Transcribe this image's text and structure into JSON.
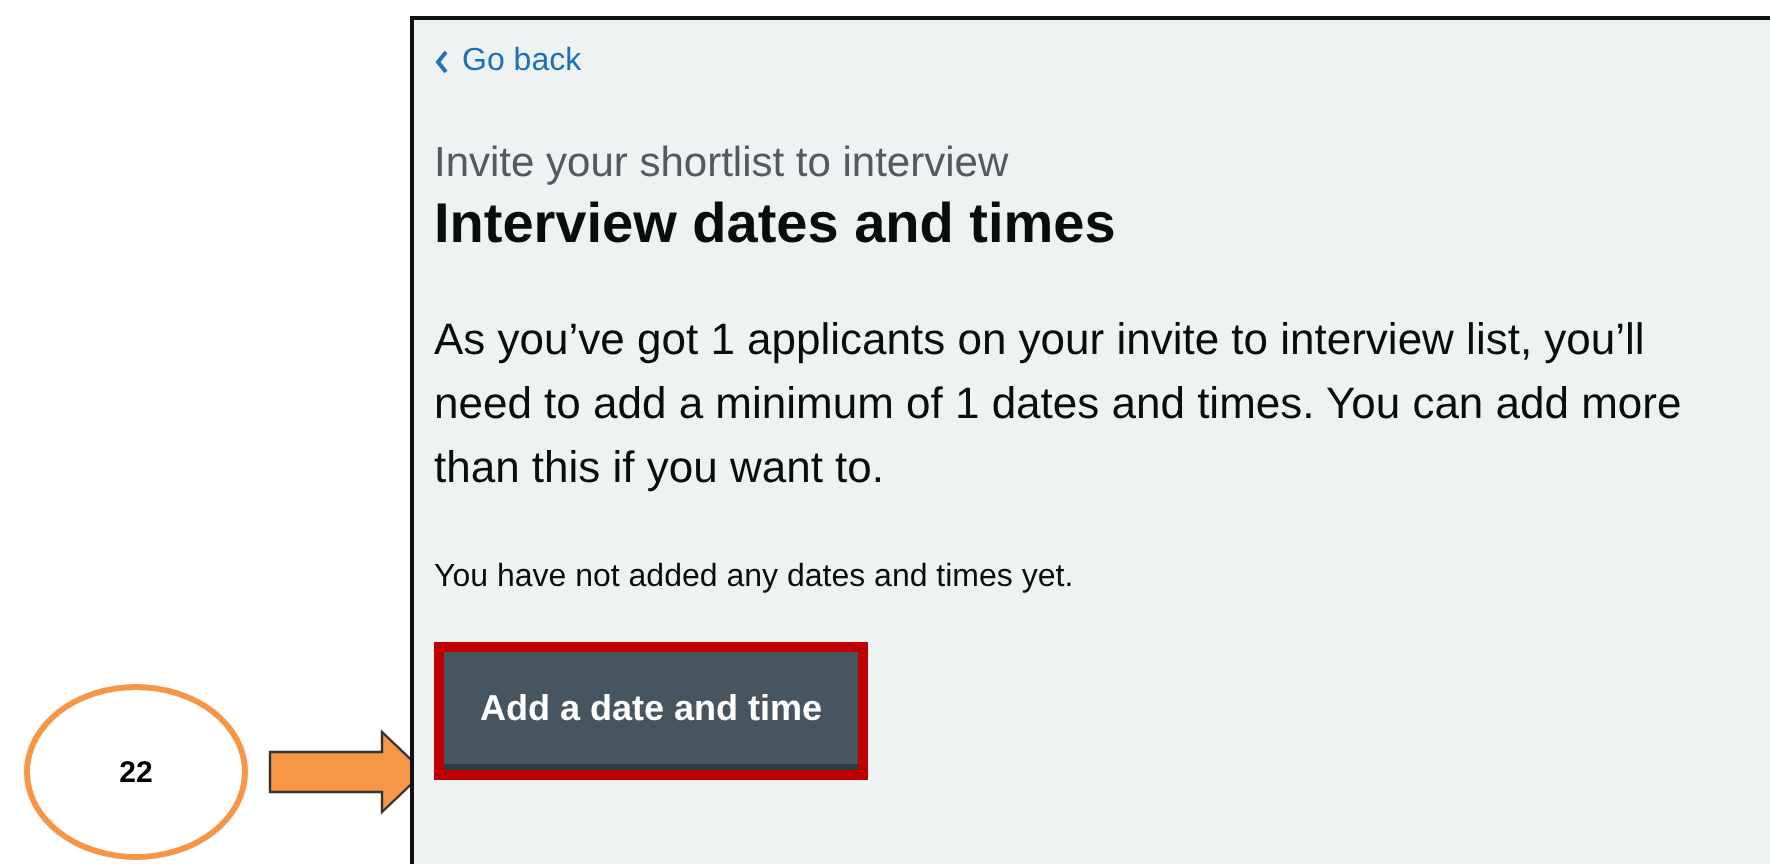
{
  "annotation": {
    "step": "22"
  },
  "page": {
    "back_link": "Go back",
    "caption": "Invite your shortlist to interview",
    "heading": "Interview dates and times",
    "body": "As you’ve got 1 applicants on your invite to interview list, you’ll need to add a minimum of 1 dates and times. You can add more than this if you want to.",
    "status": "You have not added any dates and times yet.",
    "button": {
      "label": "Add a date and time",
      "highlighted": true
    }
  }
}
